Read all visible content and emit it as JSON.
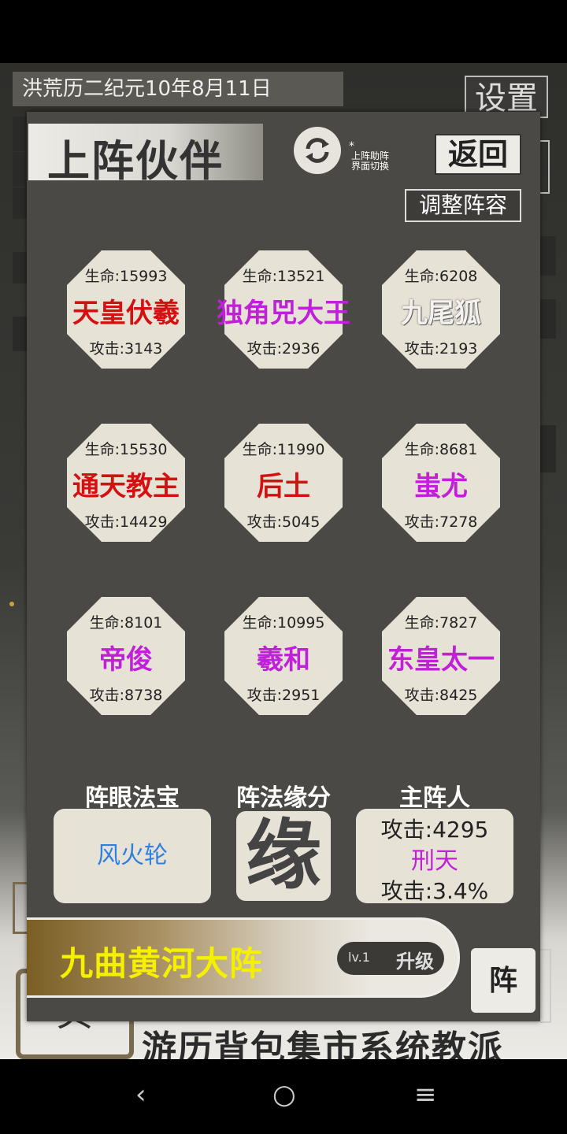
{
  "background": {
    "date": "洪荒历二纪元10年8月11日",
    "settings_label": "设置",
    "bottom_nav_text": "游历背包集市系统教派",
    "bottom_emblem": "贝"
  },
  "panel": {
    "title": "上阵伙伴",
    "switch_star": "*",
    "switch_label_1": "上阵助阵",
    "switch_label_2": "界面切换",
    "back_label": "返回",
    "adjust_label": "调整阵容",
    "cards": [
      {
        "hp": "生命:15993",
        "name": "天皇伏羲",
        "atk": "攻击:3143",
        "color": "#d41010"
      },
      {
        "hp": "生命:13521",
        "name": "独角兕大王",
        "atk": "攻击:2936",
        "color": "#c020d8"
      },
      {
        "hp": "生命:6208",
        "name": "九尾狐",
        "atk": "攻击:2193",
        "color": "#f4f2ee"
      },
      {
        "hp": "生命:15530",
        "name": "通天教主",
        "atk": "攻击:14429",
        "color": "#d41010"
      },
      {
        "hp": "生命:11990",
        "name": "后土",
        "atk": "攻击:5045",
        "color": "#d41010"
      },
      {
        "hp": "生命:8681",
        "name": "蚩尤",
        "atk": "攻击:7278",
        "color": "#c020d8"
      },
      {
        "hp": "生命:8101",
        "name": "帝俊",
        "atk": "攻击:8738",
        "color": "#c020d8"
      },
      {
        "hp": "生命:10995",
        "name": "羲和",
        "atk": "攻击:2951",
        "color": "#c020d8"
      },
      {
        "hp": "生命:7827",
        "name": "东皇太一",
        "atk": "攻击:8425",
        "color": "#c020d8"
      }
    ],
    "treasure_label": "阵眼法宝",
    "treasure_value": "风火轮",
    "fate_label": "阵法缘分",
    "fate_char": "缘",
    "leader_label": "主阵人",
    "leader_line1": "攻击:4295",
    "leader_name": "刑天",
    "leader_line3": "攻击:3.4%",
    "formation_name": "九曲黄河大阵",
    "formation_level": "lv.1",
    "upgrade_label": "升级",
    "zhen_label": "阵"
  },
  "system_nav": {
    "back": "‹",
    "home": "○",
    "recents": "≡"
  }
}
